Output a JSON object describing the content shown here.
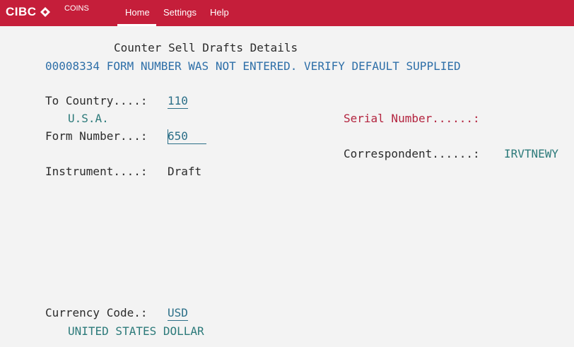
{
  "header": {
    "brand": "CIBC",
    "app_name": "COINS",
    "nav": [
      {
        "label": "Home",
        "active": true
      },
      {
        "label": "Settings",
        "active": false
      },
      {
        "label": "Help",
        "active": false
      }
    ],
    "bar_color": "#c51e3a"
  },
  "screen": {
    "title": "Counter Sell Drafts Details",
    "message": "00008334 FORM NUMBER WAS NOT ENTERED. VERIFY DEFAULT SUPPLIED",
    "to_country": {
      "label": "To Country....:",
      "value": "110",
      "description": "U.S.A."
    },
    "form_number": {
      "label": "Form Number...:",
      "value": "650"
    },
    "instrument": {
      "label": "Instrument....:",
      "value": "Draft"
    },
    "serial_number": {
      "label": "Serial Number......:",
      "value": ""
    },
    "correspondent": {
      "label": "Correspondent......:",
      "value": "IRVTNEWY"
    },
    "currency_code": {
      "label": "Currency Code.:",
      "value": "USD",
      "description": "UNITED STATES DOLLAR"
    }
  }
}
